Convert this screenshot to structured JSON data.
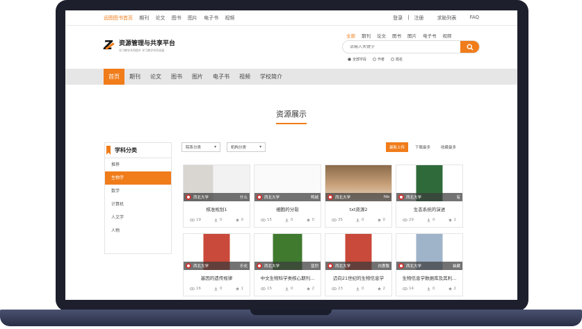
{
  "topbar": {
    "left": [
      "远图图书首页",
      "期刊",
      "论文",
      "图书",
      "图片",
      "电子书",
      "视频"
    ],
    "right": [
      "登录",
      "注册",
      "求助列表",
      "FAQ"
    ]
  },
  "header": {
    "logo_title": "资源管理与共享平台",
    "logo_sub": "学习教学共同提升 学习教学共同发展",
    "search_tabs": [
      "全部",
      "期刊",
      "论文",
      "图书",
      "图片",
      "电子书",
      "视频"
    ],
    "search_placeholder": "请输入关键字",
    "radios": [
      "全部字段",
      "作者",
      "题名"
    ]
  },
  "nav": [
    "首页",
    "期刊",
    "论文",
    "图书",
    "图片",
    "电子书",
    "视频",
    "学校简介"
  ],
  "section_title": "资源展示",
  "sidebar": {
    "title": "学科分类",
    "items": [
      "推荐",
      "生物学",
      "数学",
      "计算机",
      "人文学",
      "人物"
    ]
  },
  "filters": [
    "院系分类",
    "机构分类"
  ],
  "sorts": [
    "最新上传",
    "下载最多",
    "收藏最多"
  ],
  "cards": [
    {
      "title": "核准规划1",
      "inst": "西北大学",
      "sub": "什么",
      "views": "19",
      "downloads": "0",
      "favs": "0"
    },
    {
      "title": "细胞的分裂",
      "inst": "西北大学",
      "sub": "鸭城",
      "views": "15",
      "downloads": "0",
      "favs": "0"
    },
    {
      "title": "txt资源2",
      "inst": "西北大学",
      "sub": "fds",
      "views": "35",
      "downloads": "0",
      "favs": "0"
    },
    {
      "title": "生态系统的演进",
      "inst": "西北大学",
      "sub": "有",
      "views": "29",
      "downloads": "0",
      "favs": "1"
    },
    {
      "title": "基因的遗传规律",
      "inst": "西北大学",
      "sub": "乐化",
      "views": "16",
      "downloads": "0",
      "favs": "1"
    },
    {
      "title": "中文生物科学类核心期刊...",
      "inst": "西北大学",
      "sub": "蓝烈",
      "views": "15",
      "downloads": "0",
      "favs": "2"
    },
    {
      "title": "迈向21世纪的生物信息学",
      "inst": "西北大学",
      "sub": "白惠敬",
      "views": "23",
      "downloads": "0",
      "favs": "2"
    },
    {
      "title": "生物信息学数据库及其利...",
      "inst": "西北大学",
      "sub": "装藏",
      "views": "14",
      "downloads": "0",
      "favs": "2"
    }
  ],
  "colors": {
    "accent": "#f07c1a",
    "frame": "#1d1f2c"
  }
}
